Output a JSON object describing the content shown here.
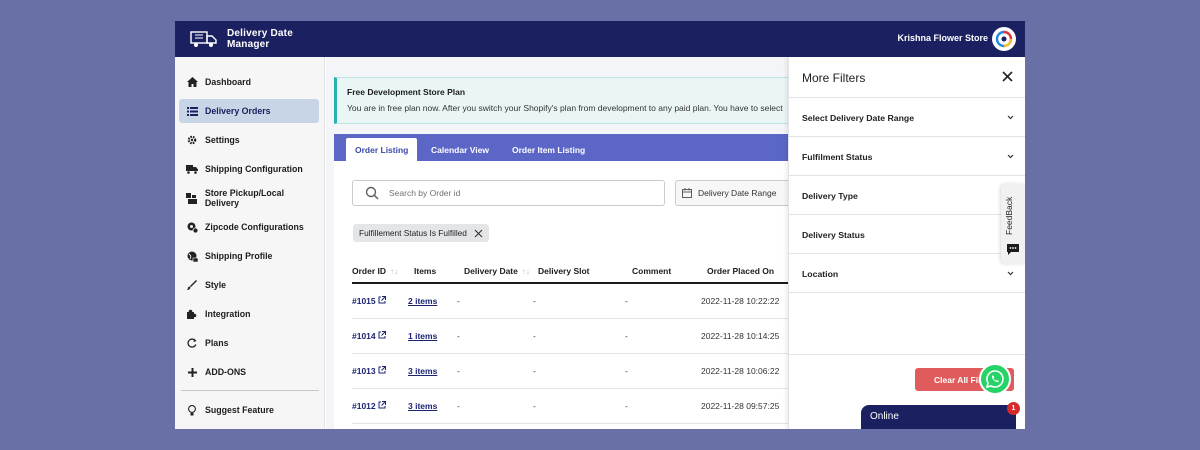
{
  "app": {
    "name": "Delivery Date Manager",
    "store_name": "Krishna Flower Store"
  },
  "colors": {
    "topbar": "#1b2060",
    "accent": "#5b66c7",
    "banner_border": "#2ab3ad",
    "danger": "#e05c5c",
    "whatsapp": "#25d366"
  },
  "sidebar": {
    "items": [
      {
        "label": "Dashboard",
        "icon": "home-icon"
      },
      {
        "label": "Delivery Orders",
        "icon": "list-icon",
        "active": true
      },
      {
        "label": "Settings",
        "icon": "gear-icon"
      },
      {
        "label": "Shipping Configuration",
        "icon": "truck-icon"
      },
      {
        "label": "Store Pickup/Local Delivery",
        "icon": "store-icon"
      },
      {
        "label": "Zipcode Configurations",
        "icon": "location-icon"
      },
      {
        "label": "Shipping Profile",
        "icon": "globe-icon"
      },
      {
        "label": "Style",
        "icon": "brush-icon"
      },
      {
        "label": "Integration",
        "icon": "puzzle-icon"
      },
      {
        "label": "Plans",
        "icon": "refresh-icon"
      },
      {
        "label": "ADD-ONS",
        "icon": "plus-icon"
      },
      {
        "label": "Suggest Feature",
        "icon": "bulb-icon"
      }
    ]
  },
  "banner": {
    "title": "Free Development Store Plan",
    "text": "You are in free plan now. After you switch your Shopify's plan from development to any paid plan. You have to select"
  },
  "tabs": [
    {
      "label": "Order Listing",
      "active": true
    },
    {
      "label": "Calendar View"
    },
    {
      "label": "Order Item Listing"
    }
  ],
  "search": {
    "placeholder": "Search by Order id",
    "value": ""
  },
  "date_range": {
    "label": "Delivery Date Range"
  },
  "active_filter": {
    "label": "Fulfillement Status Is Fulfilled"
  },
  "table": {
    "columns": [
      "Order ID",
      "Items",
      "Delivery Date",
      "Delivery Slot",
      "Comment",
      "Order Placed On"
    ],
    "rows": [
      {
        "order_id": "#1015",
        "items": "2 items",
        "delivery_date": "-",
        "delivery_slot": "-",
        "comment": "-",
        "placed_on": "2022-11-28 10:22:22"
      },
      {
        "order_id": "#1014",
        "items": "1 items",
        "delivery_date": "-",
        "delivery_slot": "-",
        "comment": "-",
        "placed_on": "2022-11-28 10:14:25"
      },
      {
        "order_id": "#1013",
        "items": "3 items",
        "delivery_date": "-",
        "delivery_slot": "-",
        "comment": "-",
        "placed_on": "2022-11-28 10:06:22"
      },
      {
        "order_id": "#1012",
        "items": "3 items",
        "delivery_date": "-",
        "delivery_slot": "-",
        "comment": "-",
        "placed_on": "2022-11-28 09:57:25"
      }
    ]
  },
  "filters_panel": {
    "title": "More Filters",
    "filters": [
      {
        "label": "Select Delivery Date Range"
      },
      {
        "label": "Fulfilment Status"
      },
      {
        "label": "Delivery Type"
      },
      {
        "label": "Delivery Status"
      },
      {
        "label": "Location"
      }
    ],
    "clear_label": "Clear All Filters"
  },
  "feedback": {
    "label": "FeedBack"
  },
  "chat": {
    "status": "Online",
    "badge": "1"
  }
}
